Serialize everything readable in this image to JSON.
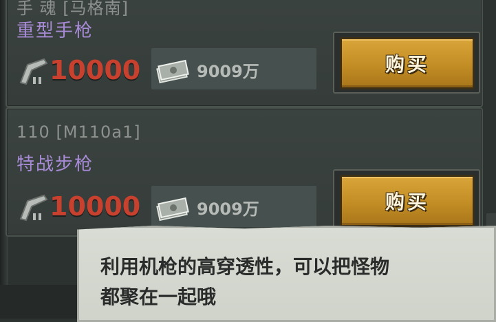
{
  "items": [
    {
      "name_line": "手 魂 [马格南]",
      "weapon_type": "重型手枪",
      "price": "10000",
      "cash": "9009万",
      "buy_label": "购买"
    },
    {
      "name_line": "110 [M110a1]",
      "weapon_type": "特战步枪",
      "price": "10000",
      "cash": "9009万",
      "buy_label": "购买"
    }
  ],
  "dialog": {
    "line1": "利用机枪的高穿透性，可以把怪物",
    "line2": "都聚在一起哦"
  },
  "icons": {
    "ammo": "pistol-ammo-icon",
    "cash": "cash-stack-icon"
  },
  "colors": {
    "price": "#c8402e",
    "weapon_type": "#a88bd6",
    "button": "#c28d24"
  }
}
